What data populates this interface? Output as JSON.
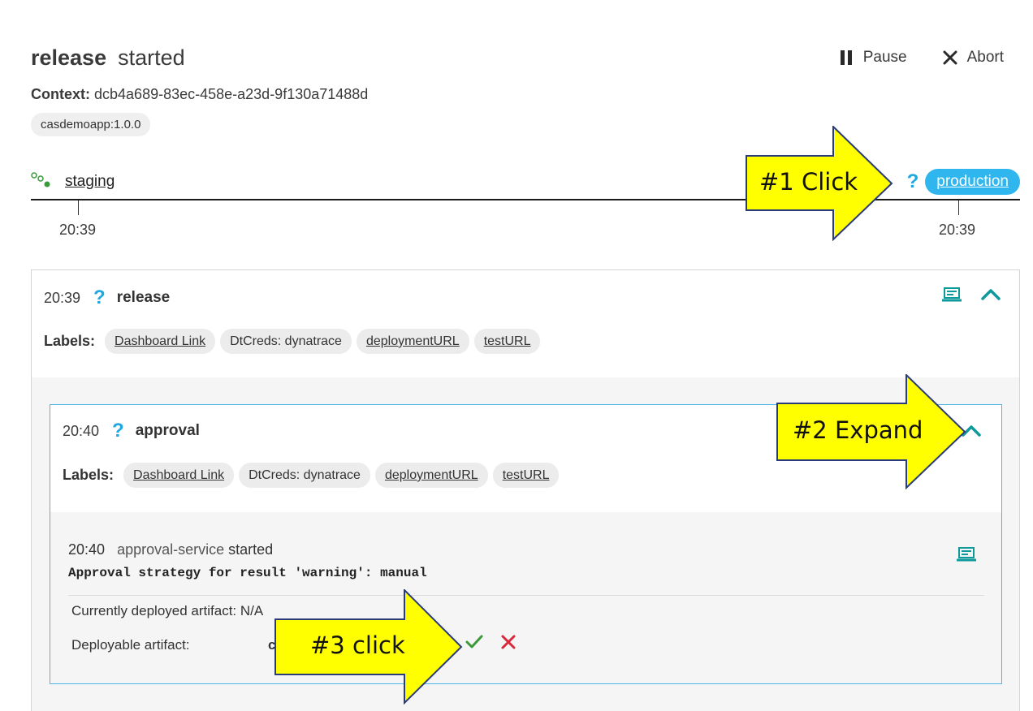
{
  "header": {
    "title": "release",
    "status": "started",
    "pause_label": "Pause",
    "abort_label": "Abort",
    "context_label": "Context:",
    "context_id": "dcb4a689-83ec-458e-a23d-9f130a71488d",
    "artifact": "casdemoapp:1.0.0"
  },
  "timeline": {
    "stages": [
      {
        "name": "staging",
        "time": "20:39"
      },
      {
        "name": "production",
        "time": "20:39"
      }
    ]
  },
  "sequence": {
    "time": "20:39",
    "name": "release",
    "labels_title": "Labels:",
    "labels": [
      "Dashboard Link",
      "DtCreds: dynatrace",
      "deploymentURL",
      "testURL"
    ]
  },
  "approval": {
    "time": "20:40",
    "name": "approval",
    "labels_title": "Labels:",
    "labels": [
      "Dashboard Link",
      "DtCreds: dynatrace",
      "deploymentURL",
      "testURL"
    ],
    "event": {
      "time": "20:40",
      "service": "approval-service",
      "status": "started",
      "message": "Approval strategy for result 'warning': manual"
    },
    "currently_deployed_label": "Currently deployed artifact:",
    "currently_deployed_value": "N/A",
    "deployable_label": "Deployable artifact:",
    "deployable_value": "c"
  },
  "callouts": {
    "c1": "#1 Click",
    "c2": "#2 Expand",
    "c3": "#3 click"
  },
  "colors": {
    "accent_blue": "#30b6ef",
    "teal": "#0e9a9a",
    "approve_green": "#3a9a3a",
    "reject_red": "#d8283a",
    "callout_yellow": "#ffff00"
  }
}
